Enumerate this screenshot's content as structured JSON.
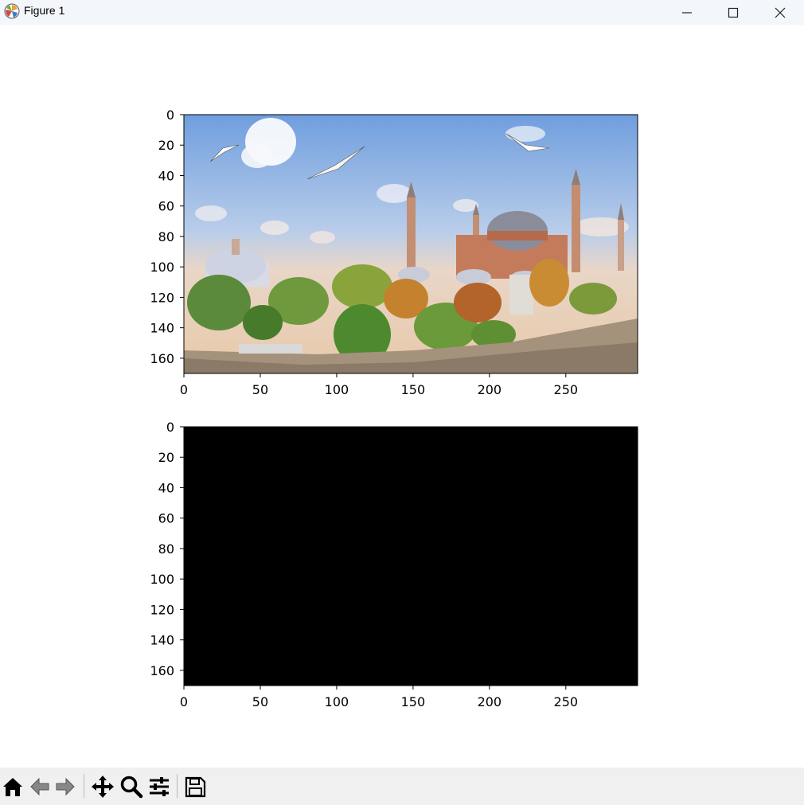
{
  "window": {
    "title": "Figure 1",
    "minimize_icon": "minimize-icon",
    "maximize_icon": "maximize-icon",
    "close_icon": "close-icon"
  },
  "toolbar": {
    "buttons": [
      {
        "name": "home-button",
        "icon": "home-icon"
      },
      {
        "name": "back-button",
        "icon": "back-arrow-icon"
      },
      {
        "name": "forward-button",
        "icon": "forward-arrow-icon"
      },
      {
        "name": "pan-button",
        "icon": "move-icon"
      },
      {
        "name": "zoom-button",
        "icon": "magnifier-icon"
      },
      {
        "name": "configure-subplots-button",
        "icon": "sliders-icon"
      },
      {
        "name": "save-button",
        "icon": "floppy-disk-icon"
      }
    ]
  },
  "colors": {
    "titlebar": "#f3f6fb",
    "toolbar": "#f0f0f0",
    "axes_frame": "#000000",
    "second_image": "#000000"
  },
  "chart_data": [
    {
      "type": "image",
      "content": "photo",
      "xlim": [
        0,
        297
      ],
      "ylim": [
        170,
        0
      ],
      "xticks": [
        0,
        50,
        100,
        150,
        200,
        250
      ],
      "yticks": [
        0,
        20,
        40,
        60,
        80,
        100,
        120,
        140,
        160
      ],
      "xticklabels": [
        "0",
        "50",
        "100",
        "150",
        "200",
        "250"
      ],
      "yticklabels": [
        "0",
        "20",
        "40",
        "60",
        "80",
        "100",
        "120",
        "140",
        "160"
      ]
    },
    {
      "type": "image",
      "content": "all black",
      "xlim": [
        0,
        297
      ],
      "ylim": [
        170,
        0
      ],
      "xticks": [
        0,
        50,
        100,
        150,
        200,
        250
      ],
      "yticks": [
        0,
        20,
        40,
        60,
        80,
        100,
        120,
        140,
        160
      ],
      "xticklabels": [
        "0",
        "50",
        "100",
        "150",
        "200",
        "250"
      ],
      "yticklabels": [
        "0",
        "20",
        "40",
        "60",
        "80",
        "100",
        "120",
        "140",
        "160"
      ]
    }
  ]
}
